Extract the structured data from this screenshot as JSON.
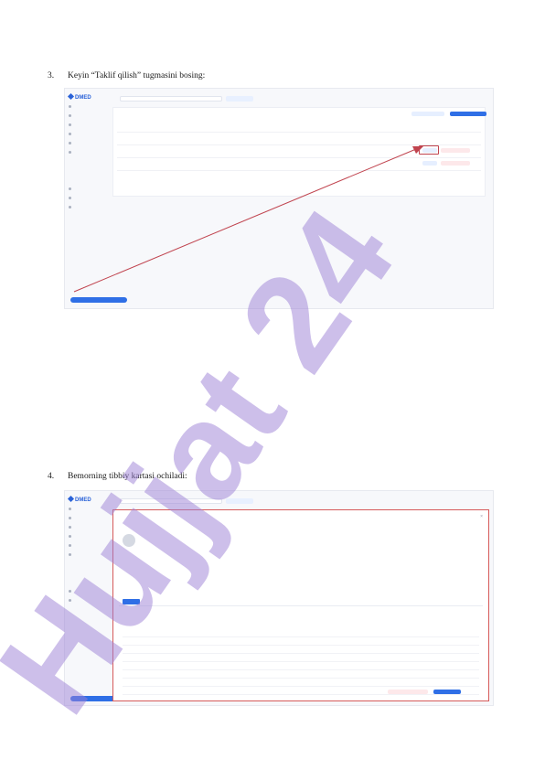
{
  "steps": [
    {
      "number": "3.",
      "text": "Keyin “Taklif qilish” tugmasini bosing:"
    },
    {
      "number": "4.",
      "text": "Bemorning tibbiy kartasi ochiladi:"
    }
  ],
  "screenshot_1": {
    "logo": "DMED",
    "sidebar_items": [
      "",
      "",
      "",
      "",
      "",
      "",
      "",
      "",
      "",
      "",
      "",
      "",
      ""
    ],
    "rows": 2,
    "highlighted_button": "Taklif qilish"
  },
  "screenshot_2": {
    "logo": "DMED",
    "modal_rows": 10
  },
  "watermark": {
    "text": "Hujjat 24",
    "color": "#9b7fd6"
  },
  "colors": {
    "accent": "#2a62d8",
    "highlight": "#c0434e"
  }
}
